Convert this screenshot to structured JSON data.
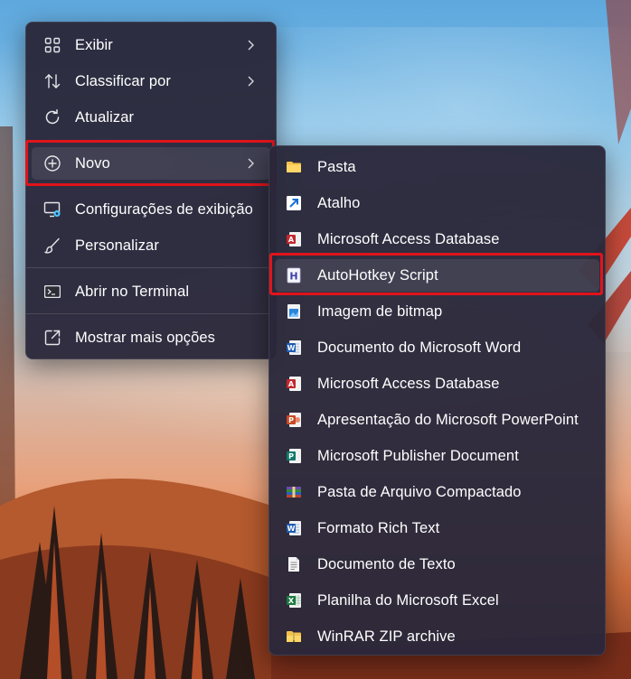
{
  "primary_menu": {
    "items": [
      {
        "label": "Exibir",
        "icon": "grid-icon",
        "submenu": true
      },
      {
        "label": "Classificar por",
        "icon": "sort-icon",
        "submenu": true
      },
      {
        "label": "Atualizar",
        "icon": "refresh-icon",
        "submenu": false
      },
      {
        "label": "Novo",
        "icon": "add-circle-icon",
        "submenu": true
      },
      {
        "label": "Configurações de exibição",
        "icon": "display-settings-icon",
        "submenu": false
      },
      {
        "label": "Personalizar",
        "icon": "brush-icon",
        "submenu": false
      },
      {
        "label": "Abrir no Terminal",
        "icon": "terminal-icon",
        "submenu": false
      },
      {
        "label": "Mostrar mais opções",
        "icon": "open-external-icon",
        "submenu": false
      }
    ],
    "highlighted_item": "Novo"
  },
  "new_submenu": {
    "items": [
      {
        "label": "Pasta",
        "icon": "folder-icon"
      },
      {
        "label": "Atalho",
        "icon": "shortcut-icon"
      },
      {
        "label": "Microsoft Access Database",
        "icon": "access-icon"
      },
      {
        "label": "AutoHotkey Script",
        "icon": "autohotkey-icon"
      },
      {
        "label": "Imagem de bitmap",
        "icon": "bitmap-icon"
      },
      {
        "label": "Documento do Microsoft Word",
        "icon": "word-icon"
      },
      {
        "label": "Microsoft Access Database",
        "icon": "access-icon"
      },
      {
        "label": "Apresentação do Microsoft PowerPoint",
        "icon": "powerpoint-icon"
      },
      {
        "label": "Microsoft Publisher Document",
        "icon": "publisher-icon"
      },
      {
        "label": "Pasta de Arquivo Compactado",
        "icon": "zip-folder-icon"
      },
      {
        "label": "Formato Rich Text",
        "icon": "rtf-icon"
      },
      {
        "label": "Documento de Texto",
        "icon": "text-document-icon"
      },
      {
        "label": "Planilha do Microsoft Excel",
        "icon": "excel-icon"
      },
      {
        "label": "WinRAR ZIP archive",
        "icon": "winrar-icon"
      }
    ],
    "highlighted_item": "AutoHotkey Script"
  },
  "colors": {
    "menu_bg": "#2a283a",
    "highlight_border": "#e0141b",
    "accent": "#4cc2ff"
  }
}
